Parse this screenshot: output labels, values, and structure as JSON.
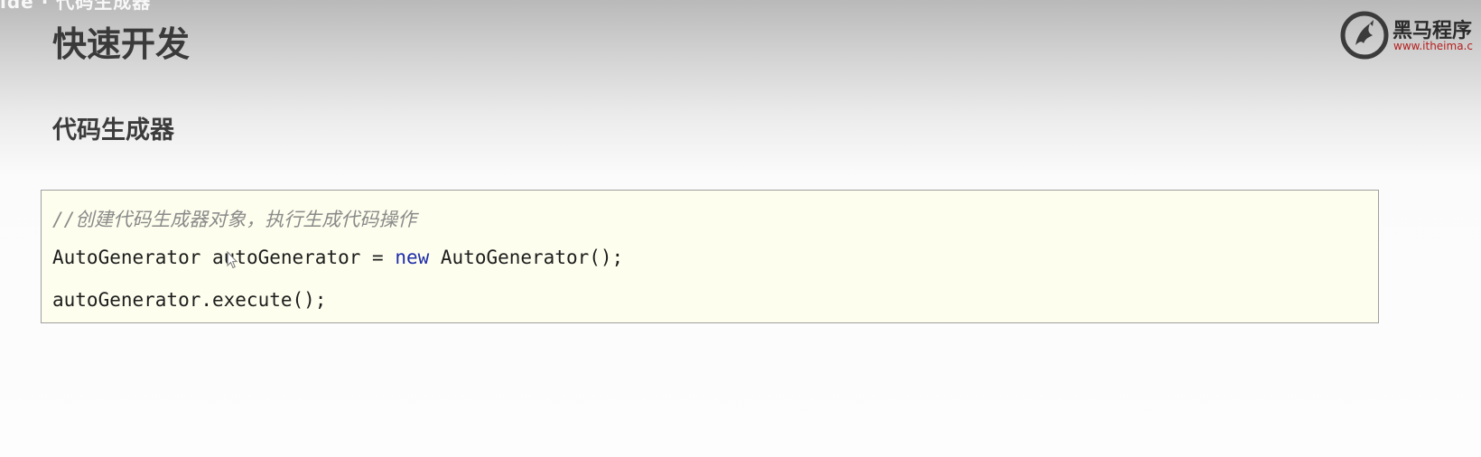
{
  "header": {
    "caption": "ide · 代码生成器",
    "title": "快速开发",
    "section_title": "代码生成器"
  },
  "logo": {
    "name": "黑马程序",
    "url": "www.itheima.c"
  },
  "code": {
    "comment": "//创建代码生成器对象，执行生成代码操作",
    "line2_type": "AutoGenerator",
    "line2_var": " autoGenerator = ",
    "line2_keyword": "new",
    "line2_ctor": " AutoGenerator();",
    "line3": "autoGenerator.execute();"
  },
  "colors": {
    "code_background": "#fefeee",
    "keyword": "#1f2eaa",
    "comment": "#8a8a8a",
    "logo_url": "#b71e1e"
  },
  "icons": {
    "logo": "horse-logo-icon",
    "cursor": "mouse-cursor-icon"
  }
}
